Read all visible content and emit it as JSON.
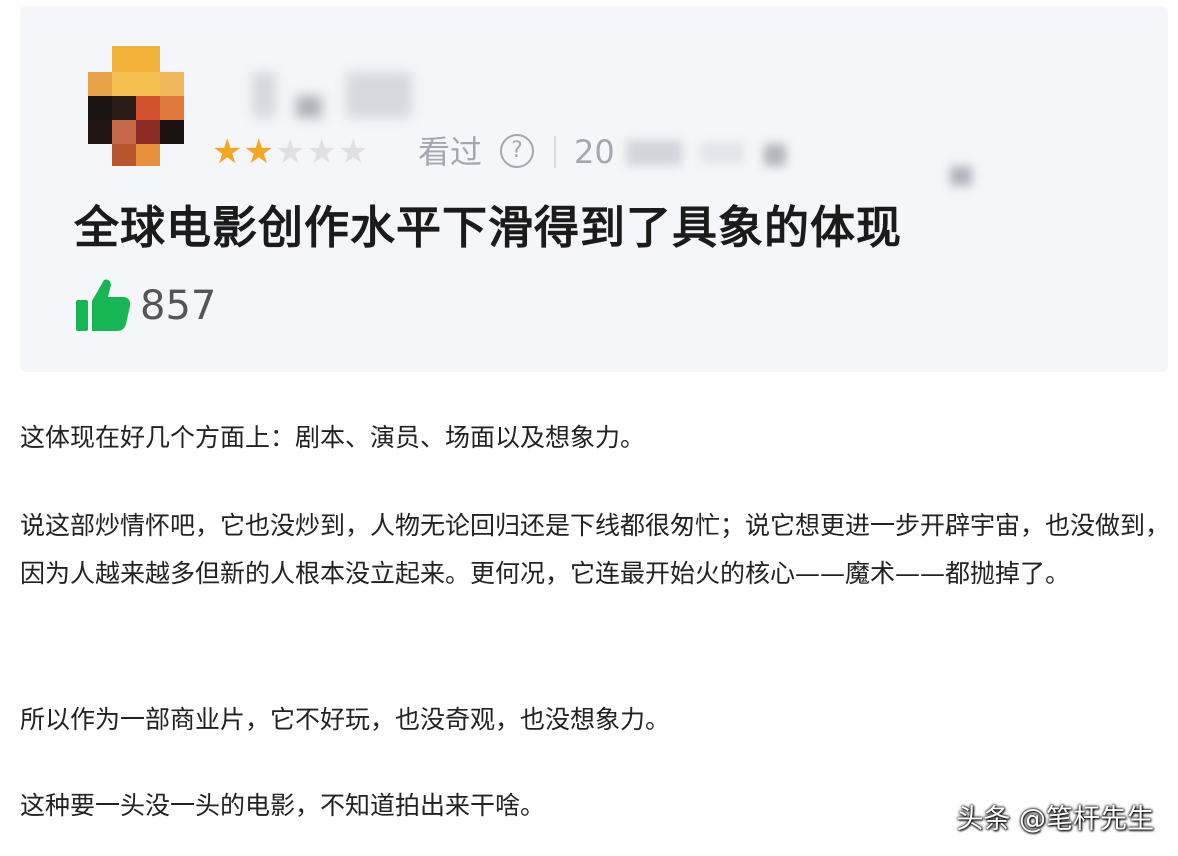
{
  "review": {
    "rating_stars": 2,
    "rating_max": 5,
    "watched_label": "看过",
    "date_prefix": "20",
    "title": "全球电影创作水平下滑得到了具象的体现",
    "likes": "857"
  },
  "body": {
    "paragraphs": [
      "这体现在好几个方面上：剧本、演员、场面以及想象力。",
      "说这部炒情怀吧，它也没炒到，人物无论回归还是下线都很匆忙；说它想更进一步开辟宇宙，也没做到，因为人越来越多但新的人根本没立起来。更何况，它连最开始火的核心——魔术——都抛掉了。",
      "所以作为一部商业片，它不好玩，也没奇观，也没想象力。",
      "这种要一头没一头的电影，不知道拍出来干啥。"
    ]
  },
  "watermark": "头条 @笔杆先生",
  "colors": {
    "star_on": "#f5a623",
    "star_off": "#e0e0e4",
    "like_green": "#16b655",
    "card_bg": "#f5f6f9"
  },
  "icons": [
    "star-icon",
    "help-circle-icon",
    "thumbs-up-icon"
  ]
}
